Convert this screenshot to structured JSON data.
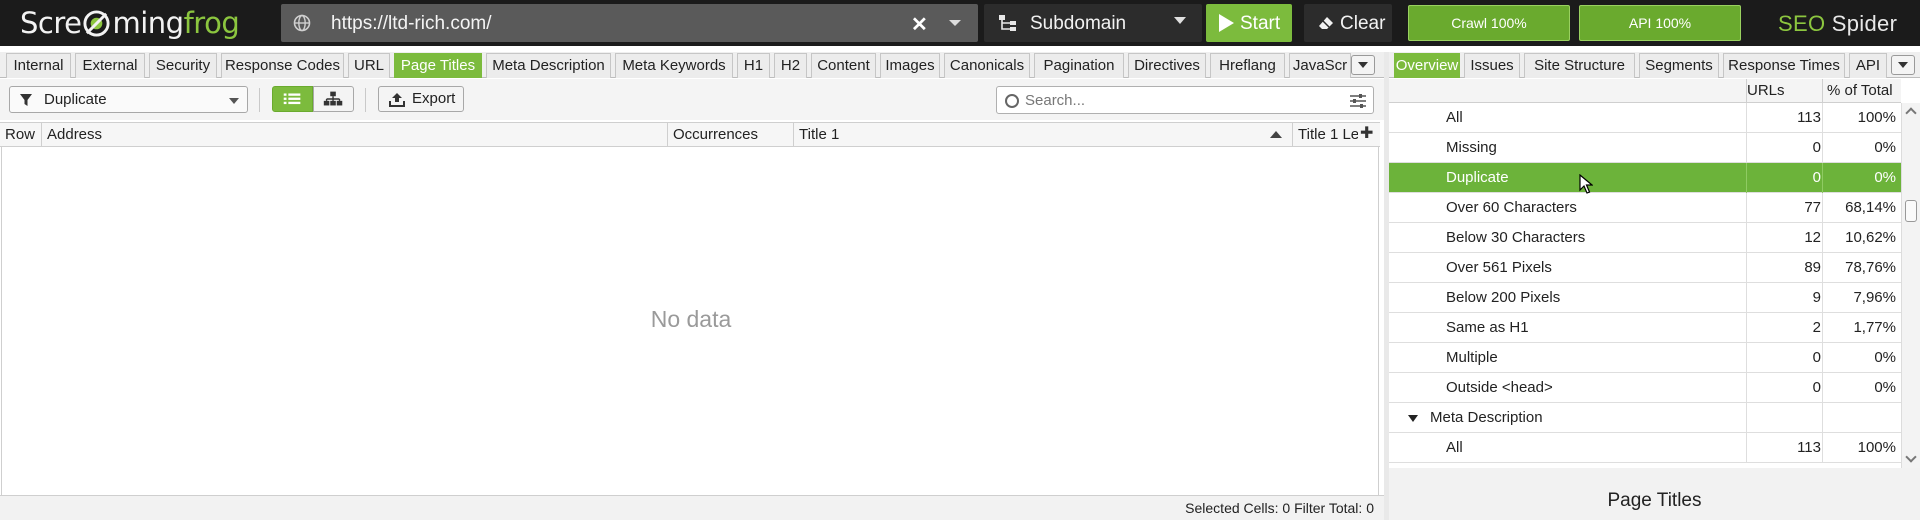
{
  "app": {
    "logo": {
      "part1": "Scre",
      "part2": "ming",
      "part3": "frog"
    },
    "brand": {
      "seo": "SEO",
      "spider": "Spider"
    }
  },
  "topbar": {
    "url": "https://ltd-rich.com/",
    "mode_label": "Subdomain",
    "start_label": "Start",
    "clear_label": "Clear",
    "crawl_progress_label": "Crawl 100%",
    "crawl_progress": 100,
    "api_progress_label": "API 100%",
    "api_progress": 100,
    "accent_color": "#7cbb3d"
  },
  "left_tabs": [
    {
      "label": "Internal"
    },
    {
      "label": "External"
    },
    {
      "label": "Security"
    },
    {
      "label": "Response Codes"
    },
    {
      "label": "URL"
    },
    {
      "label": "Page Titles",
      "active": true
    },
    {
      "label": "Meta Description"
    },
    {
      "label": "Meta Keywords"
    },
    {
      "label": "H1"
    },
    {
      "label": "H2"
    },
    {
      "label": "Content"
    },
    {
      "label": "Images"
    },
    {
      "label": "Canonicals"
    },
    {
      "label": "Pagination"
    },
    {
      "label": "Directives"
    },
    {
      "label": "Hreflang"
    },
    {
      "label": "JavaScr"
    }
  ],
  "toolbar": {
    "filter_value": "Duplicate",
    "export_label": "Export",
    "search_placeholder": "Search..."
  },
  "table": {
    "columns": [
      "Row",
      "Address",
      "Occurrences",
      "Title 1",
      "Title 1 Le"
    ],
    "empty_text": "No data"
  },
  "statusbar": {
    "text": "Selected Cells:  0  Filter Total:  0"
  },
  "right_tabs": [
    {
      "label": "Overview",
      "active": true
    },
    {
      "label": "Issues"
    },
    {
      "label": "Site Structure"
    },
    {
      "label": "Segments"
    },
    {
      "label": "Response Times"
    },
    {
      "label": "API"
    }
  ],
  "overview": {
    "col_urls": "URLs",
    "col_pct": "% of Total",
    "rows": [
      {
        "label": "All",
        "urls": "113",
        "pct": "100%"
      },
      {
        "label": "Missing",
        "urls": "0",
        "pct": "0%"
      },
      {
        "label": "Duplicate",
        "urls": "0",
        "pct": "0%",
        "selected": true
      },
      {
        "label": "Over 60 Characters",
        "urls": "77",
        "pct": "68,14%"
      },
      {
        "label": "Below 30 Characters",
        "urls": "12",
        "pct": "10,62%"
      },
      {
        "label": "Over 561 Pixels",
        "urls": "89",
        "pct": "78,76%"
      },
      {
        "label": "Below 200 Pixels",
        "urls": "9",
        "pct": "7,96%"
      },
      {
        "label": "Same as H1",
        "urls": "2",
        "pct": "1,77%"
      },
      {
        "label": "Multiple",
        "urls": "0",
        "pct": "0%"
      },
      {
        "label": "Outside <head>",
        "urls": "0",
        "pct": "0%"
      },
      {
        "label": "Meta Description",
        "urls": "",
        "pct": "",
        "group": true
      },
      {
        "label": "All",
        "urls": "113",
        "pct": "100%"
      }
    ],
    "panel_title": "Page Titles"
  }
}
